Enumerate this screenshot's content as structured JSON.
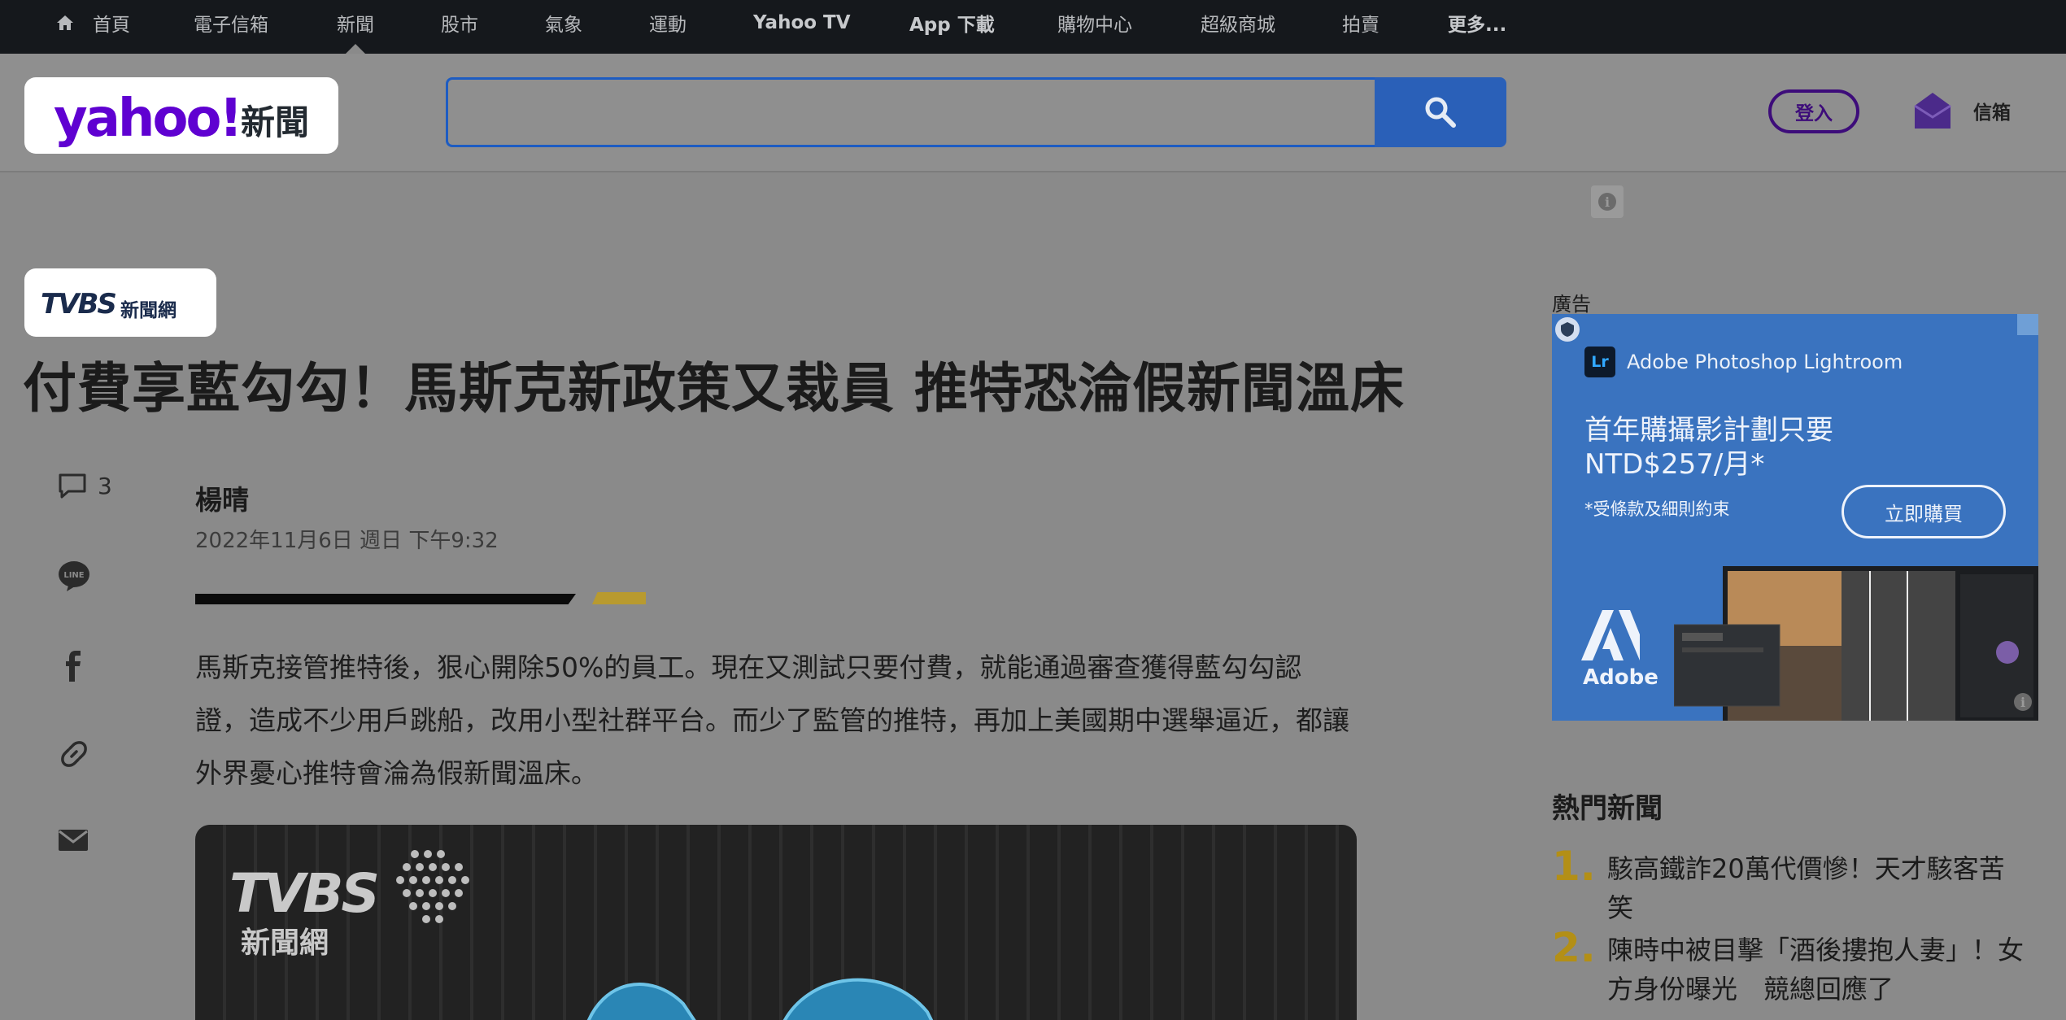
{
  "topnav": {
    "items": [
      {
        "label": "首頁"
      },
      {
        "label": "電子信箱"
      },
      {
        "label": "新聞"
      },
      {
        "label": "股市"
      },
      {
        "label": "氣象"
      },
      {
        "label": "運動"
      },
      {
        "label": "Yahoo TV"
      },
      {
        "label": "App 下載"
      },
      {
        "label": "購物中心"
      },
      {
        "label": "超級商城"
      },
      {
        "label": "拍賣"
      },
      {
        "label": "更多..."
      }
    ]
  },
  "header": {
    "logo_brand": "yahoo!",
    "logo_section": "新聞",
    "search_placeholder": "",
    "login_label": "登入",
    "mail_label": "信箱"
  },
  "article": {
    "source_logo": "TVBS",
    "source_sub": "新聞網",
    "title": "付費享藍勾勾！馬斯克新政策又裁員 推特恐淪假新聞溫床",
    "comment_count": "3",
    "author": "楊晴",
    "date": "2022年11月6日 週日 下午9:32",
    "lead": "馬斯克接管推特後，狠心開除50%的員工。現在又測試只要付費，就能通過審查獲得藍勾勾認證，造成不少用戶跳船，改用小型社群平台。而少了監管的推特，再加上美國期中選舉逼近，都讓外界憂心推特會淪為假新聞溫床。",
    "image_watermark": "TVBS",
    "image_watermark_sub": "新聞網"
  },
  "ad": {
    "label": "廣告",
    "brand": "Adobe Photoshop Lightroom",
    "brand_icon": "Lr",
    "headline_line1": "首年購攝影計劃只要",
    "headline_line2": "NTD$257/月*",
    "note": "*受條款及細則約束",
    "cta": "立即購買",
    "company": "Adobe"
  },
  "trending": {
    "title": "熱門新聞",
    "items": [
      {
        "num": "1.",
        "text": "駭高鐵詐20萬代價慘！天才駭客苦笑"
      },
      {
        "num": "2.",
        "text": "陳時中被目擊「酒後摟抱人妻」！女方身份曝光　競總回應了"
      }
    ]
  },
  "colors": {
    "accent_blue": "#2a60b8",
    "yahoo_purple": "#5f01d1",
    "trend_gold": "#b38f16",
    "nav_bg": "#15181c"
  }
}
